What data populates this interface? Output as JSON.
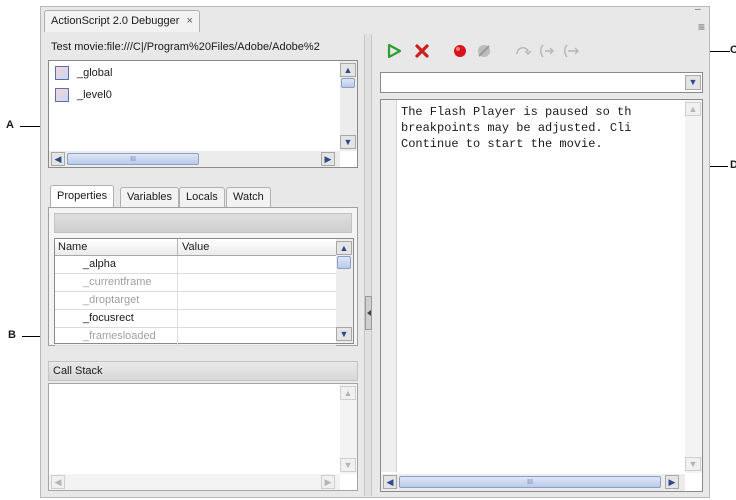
{
  "callouts": [
    "A",
    "B",
    "C",
    "D"
  ],
  "window": {
    "tab_title": "ActionScript 2.0 Debugger",
    "close_glyph": "×",
    "minimize_glyph": "–",
    "menu_glyph": "≡"
  },
  "movie_list": {
    "header": "Test movie:file:///C|/Program%20Files/Adobe/Adobe%2",
    "items": [
      "_global",
      "_level0"
    ]
  },
  "tabs": [
    "Properties",
    "Variables",
    "Locals",
    "Watch"
  ],
  "properties_table": {
    "columns": [
      "Name",
      "Value"
    ],
    "rows": [
      {
        "name": "_alpha",
        "value": "",
        "enabled": true
      },
      {
        "name": "_currentframe",
        "value": "",
        "enabled": false
      },
      {
        "name": "_droptarget",
        "value": "",
        "enabled": false
      },
      {
        "name": "_focusrect",
        "value": "",
        "enabled": true
      },
      {
        "name": "_framesloaded",
        "value": "",
        "enabled": false
      }
    ]
  },
  "call_stack": {
    "title": "Call Stack"
  },
  "toolbar": {
    "icons": [
      "continue-icon",
      "stop-debugging-icon",
      "toggle-breakpoint-icon",
      "remove-all-breakpoints-icon",
      "step-over-icon",
      "step-in-icon",
      "step-out-icon"
    ],
    "colors": {
      "continue": "#2f9e2f",
      "stop": "#cc1f1f",
      "breakpoint": "#d8141a",
      "disabled": "#b5b5b5"
    }
  },
  "code_view": {
    "lines": [
      "The Flash Player is paused so th",
      "breakpoints may be adjusted. Cli",
      "Continue to start the movie."
    ]
  },
  "scrollbar": {
    "up": "▲",
    "down": "▼",
    "left": "◀",
    "right": "▶",
    "grip": "III"
  }
}
